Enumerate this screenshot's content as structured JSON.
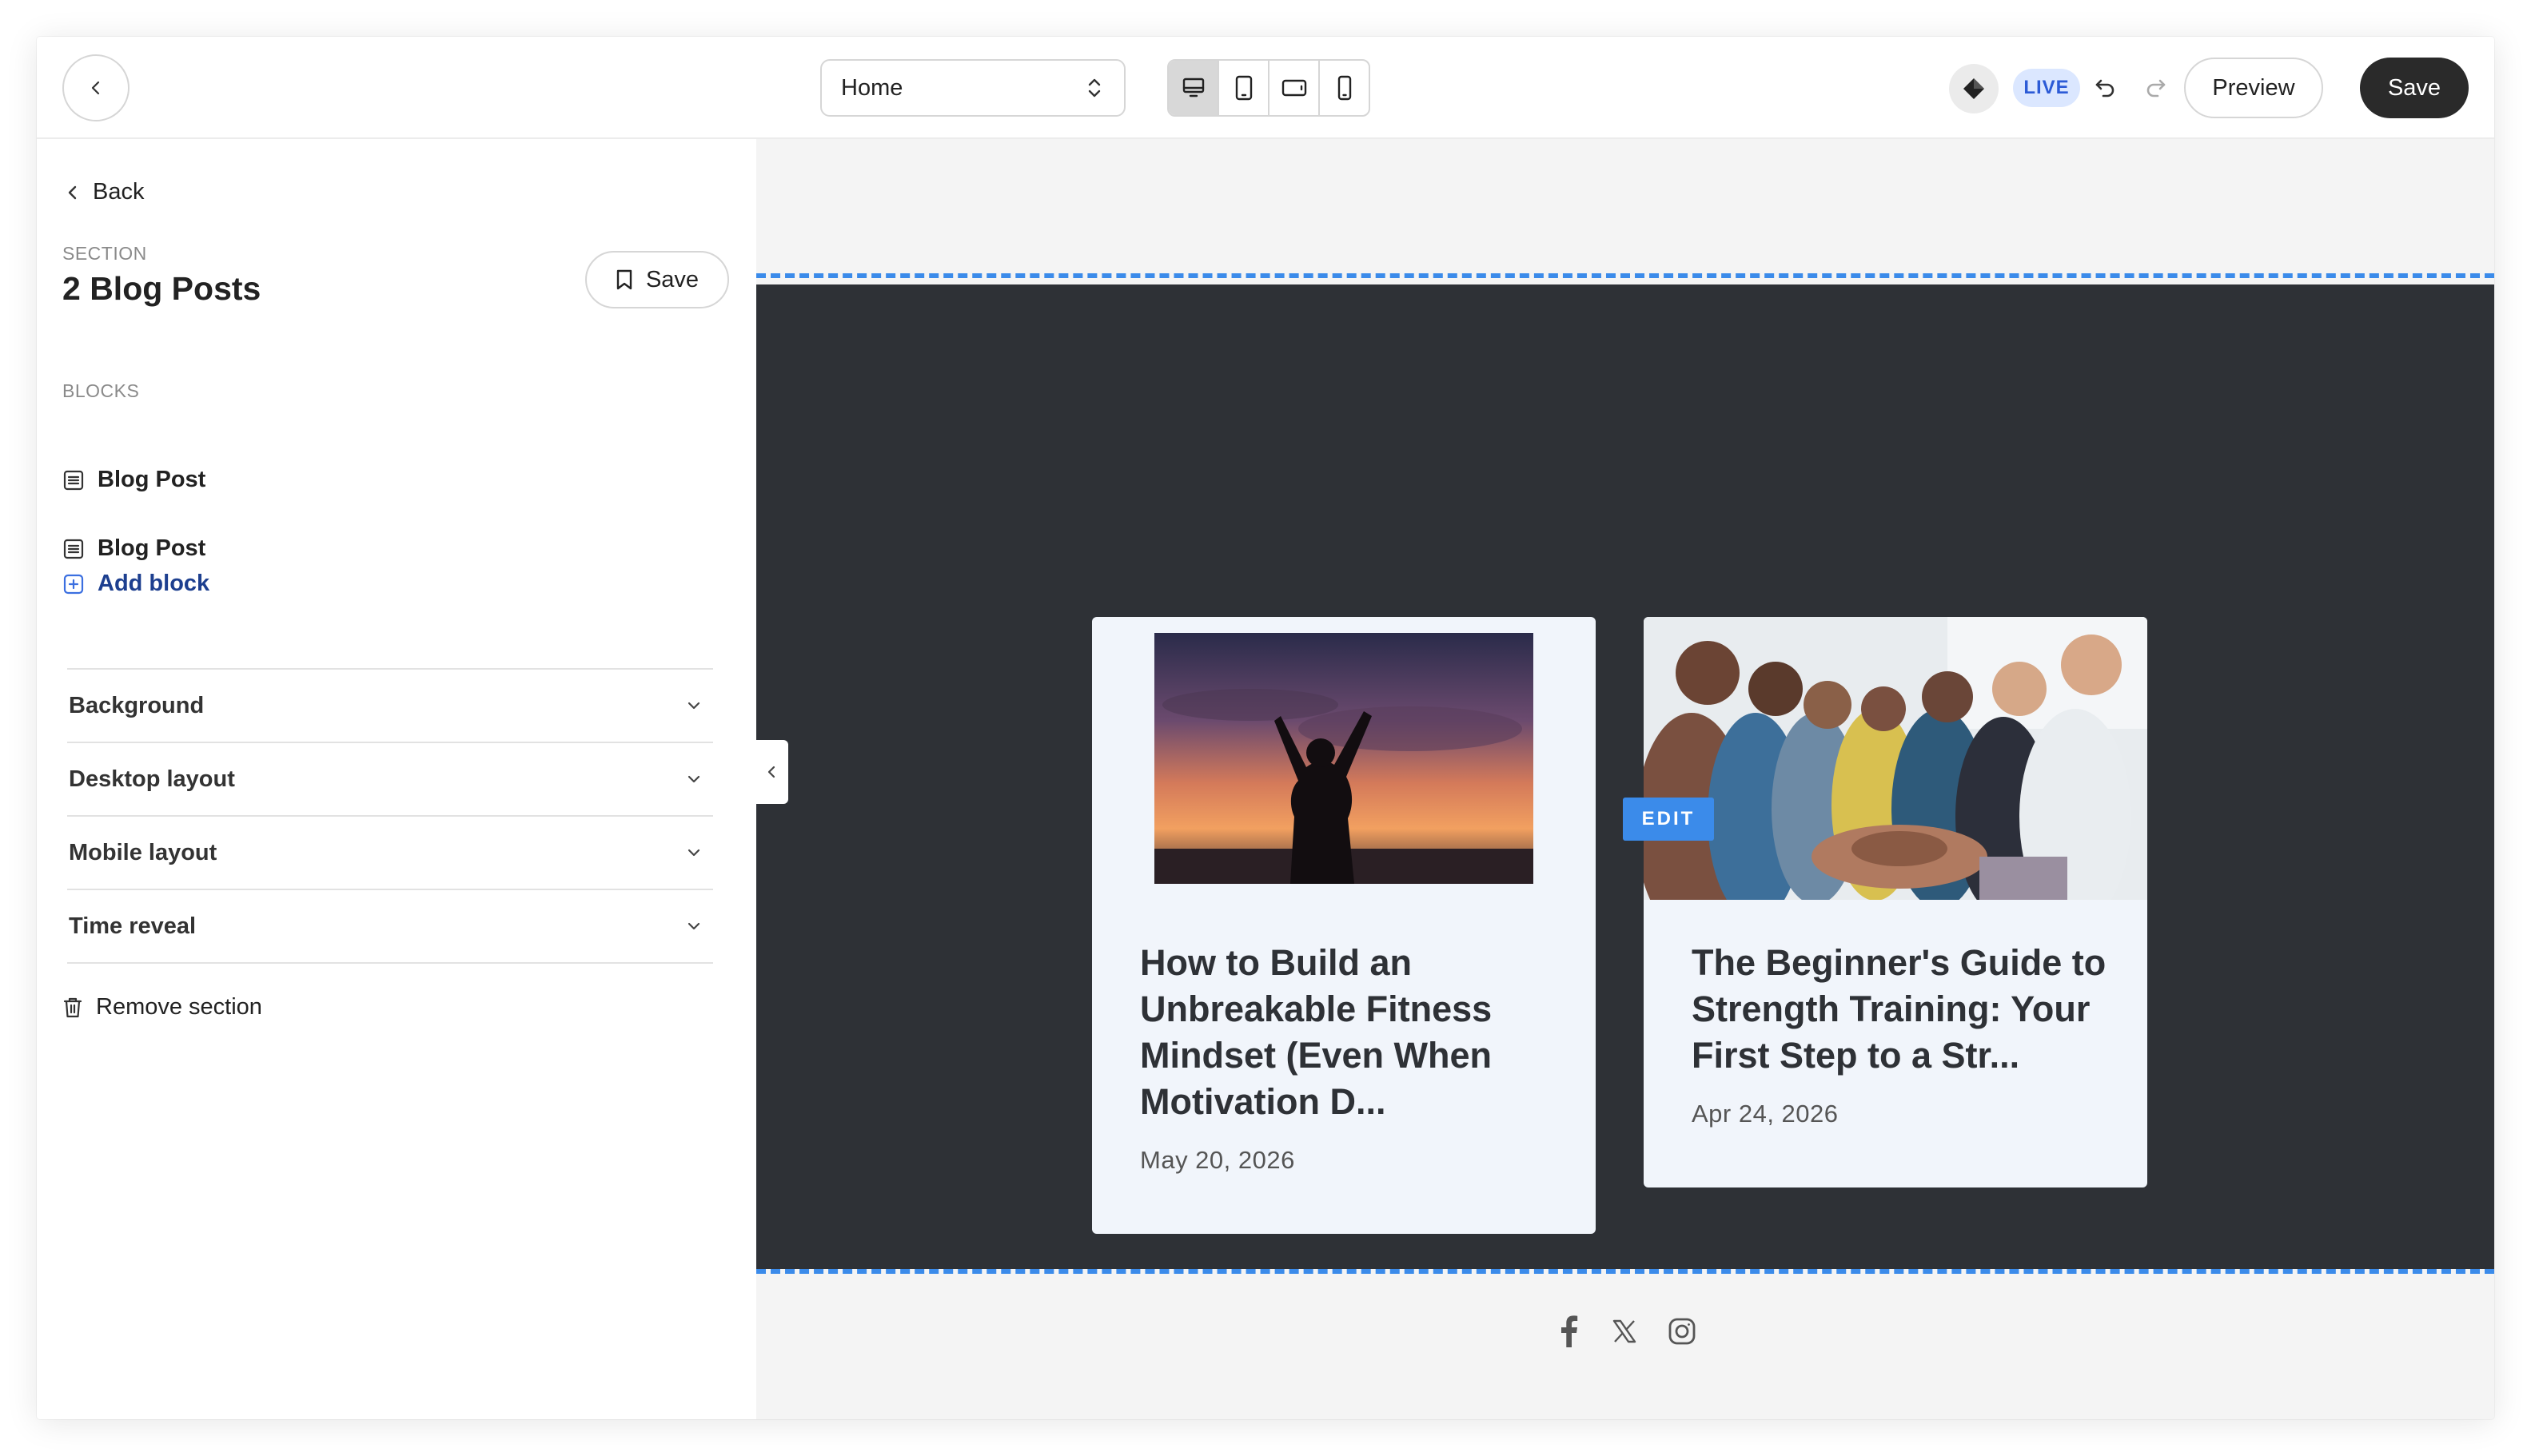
{
  "topbar": {
    "page_select": "Home",
    "live_label": "LIVE",
    "preview_label": "Preview",
    "save_label": "Save",
    "device_modes": [
      "desktop-icon",
      "tablet-portrait-icon",
      "tablet-landscape-icon",
      "mobile-icon"
    ],
    "active_device": "desktop"
  },
  "sidebar": {
    "back_label": "Back",
    "section_label": "SECTION",
    "section_title": "2 Blog Posts",
    "save_label": "Save",
    "blocks_label": "BLOCKS",
    "blocks": [
      {
        "label": "Blog Post"
      },
      {
        "label": "Blog Post"
      }
    ],
    "add_block_label": "Add block",
    "accordions": [
      {
        "label": "Background"
      },
      {
        "label": "Desktop layout"
      },
      {
        "label": "Mobile layout"
      },
      {
        "label": "Time reveal"
      }
    ],
    "remove_label": "Remove section"
  },
  "canvas": {
    "edit_label": "EDIT",
    "posts": [
      {
        "title": "How to Build an Unbreakable Fitness Mindset (Even When Motivation D...",
        "date": "May 20, 2026"
      },
      {
        "title": "The Beginner's Guide to Strength Training: Your First Step to a Str...",
        "date": "Apr 24, 2026"
      }
    ],
    "social": [
      "facebook-icon",
      "x-icon",
      "instagram-icon"
    ]
  },
  "colors": {
    "accent_blue": "#3b8bea",
    "dark_section": "#2e3136",
    "card_bg": "#f1f5fb",
    "live_bg": "#dbe7ff",
    "save_btn": "#2a2a2a"
  }
}
